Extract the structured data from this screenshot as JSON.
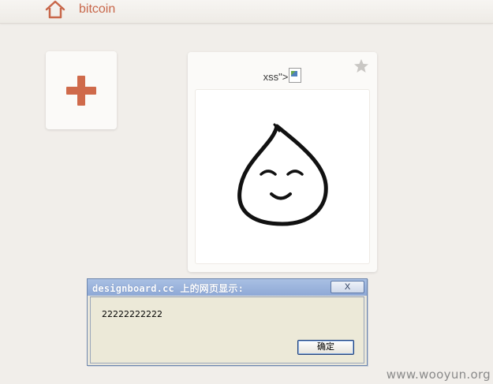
{
  "header": {
    "icon": "home-icon",
    "brand": "bitcoin"
  },
  "add_card": {
    "icon": "plus-icon",
    "accent": "#cf6a4b"
  },
  "board_card": {
    "title_text": "xss\">",
    "broken_image_icon": "broken-image-icon",
    "star_icon": "star-icon",
    "preview_icon": "smiling-drop-icon"
  },
  "dialog": {
    "title": "designboard.cc 上的网页显示:",
    "close_label": "X",
    "message": "22222222222",
    "ok_label": "确定"
  },
  "watermark": "www.wooyun.org"
}
